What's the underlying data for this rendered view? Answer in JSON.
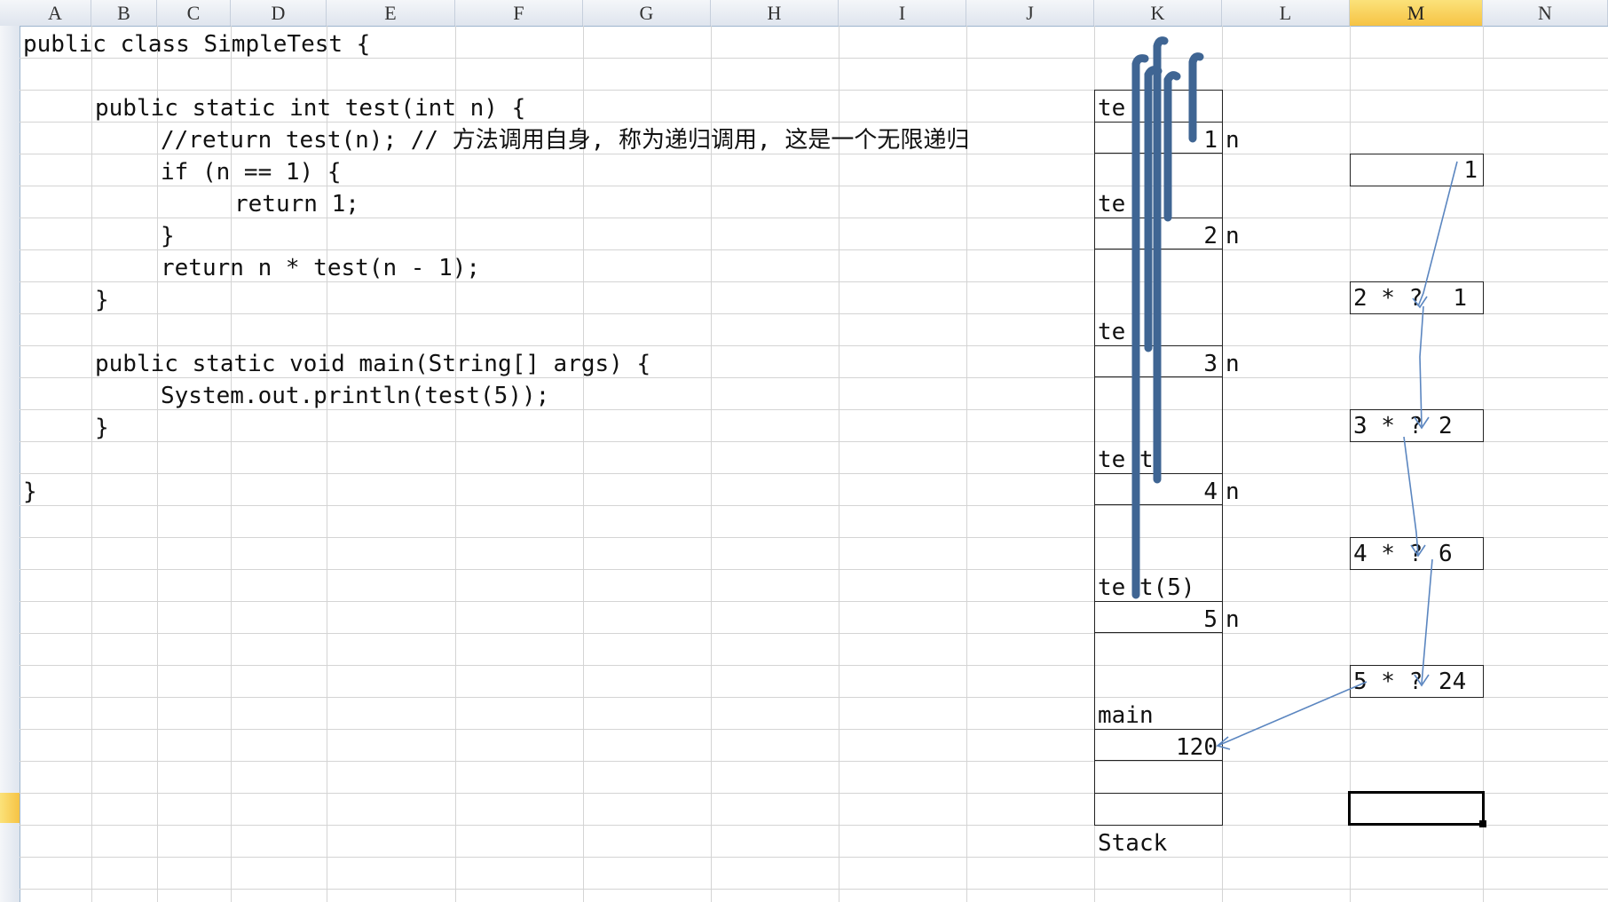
{
  "sheet": {
    "columns": [
      "A",
      "B",
      "C",
      "D",
      "E",
      "F",
      "G",
      "H",
      "I",
      "J",
      "K",
      "L",
      "M",
      "N"
    ],
    "active_column": "M"
  },
  "code": {
    "lines": [
      "public class SimpleTest {",
      "public static int test(int n) {",
      "//return test(n); // 方法调用自身, 称为递归调用, 这是一个无限递归",
      "if (n == 1) {",
      "return 1;",
      "}",
      "return n * test(n - 1);",
      "}",
      "public static void main(String[] args) {",
      "System.out.println(test(5));",
      "}",
      "}"
    ]
  },
  "stack": {
    "frames": [
      {
        "label": "te",
        "value": "1",
        "var": "n"
      },
      {
        "label": "te",
        "value": "2",
        "var": "n"
      },
      {
        "label": "te",
        "value": "3",
        "var": "n"
      },
      {
        "label": "te t",
        "value": "4",
        "var": "n"
      },
      {
        "label": "te t(5)",
        "value": "5",
        "var": "n"
      }
    ],
    "main_label": "main",
    "main_value": "120",
    "caption": "Stack"
  },
  "results": {
    "boxes": [
      {
        "expr": "",
        "value": "1"
      },
      {
        "expr": "2 * ?",
        "value": "1"
      },
      {
        "expr": "3 * ?",
        "value": "2"
      },
      {
        "expr": "4 * ?",
        "value": "6"
      },
      {
        "expr": "5 * ?",
        "value": "24"
      }
    ]
  },
  "colors": {
    "pen_strokes": "#3f6593",
    "arrows": "#5b86c0",
    "active_header": "#f6c344"
  }
}
